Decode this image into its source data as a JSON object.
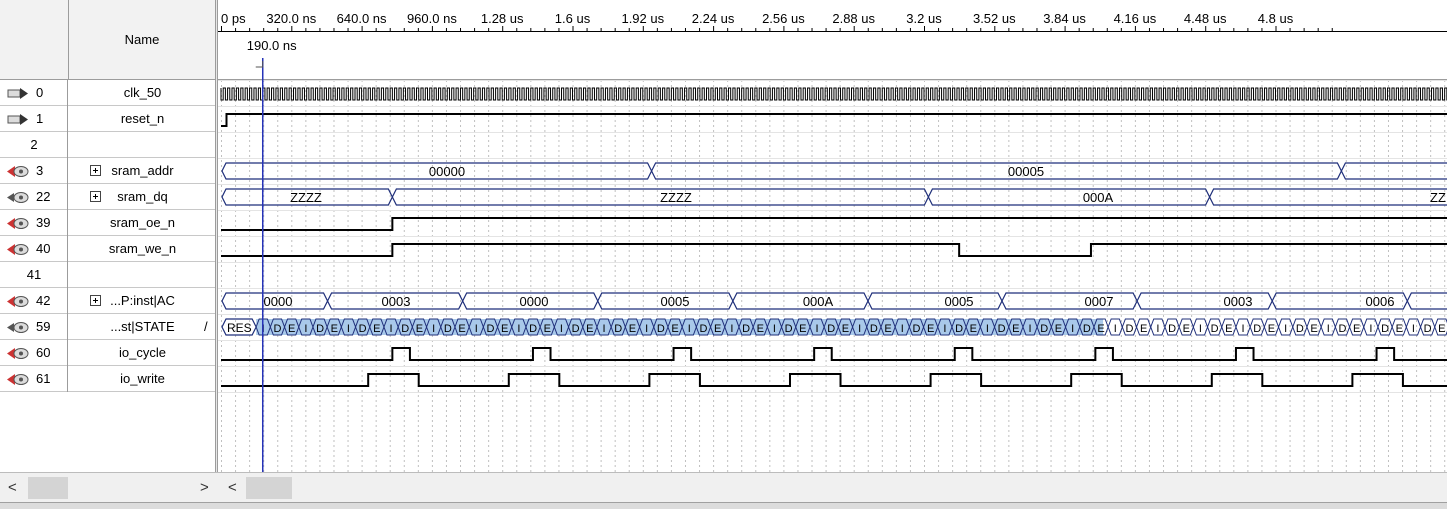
{
  "header": {
    "name_label": "Name"
  },
  "timeline": {
    "ticks": [
      "0 ps",
      "320.0 ns",
      "640.0 ns",
      "960.0 ns",
      "1.28 us",
      "1.6 us",
      "1.92 us",
      "2.24 us",
      "2.56 us",
      "2.88 us",
      "3.2 us",
      "3.52 us",
      "3.84 us",
      "4.16 us",
      "4.48 us",
      "4.8 us"
    ],
    "cursor_label": "190.0 ns",
    "cursor_time_ns": 190.0
  },
  "signals": [
    {
      "index": "0",
      "name": "clk_50",
      "pin": "input"
    },
    {
      "index": "1",
      "name": "reset_n",
      "pin": "input"
    },
    {
      "index": "2",
      "name": "",
      "pin": "none"
    },
    {
      "index": "3",
      "name": "sram_addr",
      "pin": "output",
      "expandable": true
    },
    {
      "index": "22",
      "name": "sram_dq",
      "pin": "bidir",
      "expandable": true
    },
    {
      "index": "39",
      "name": "sram_oe_n",
      "pin": "output"
    },
    {
      "index": "40",
      "name": "sram_we_n",
      "pin": "output"
    },
    {
      "index": "41",
      "name": "",
      "pin": "none"
    },
    {
      "index": "42",
      "name": "...P:inst|AC",
      "pin": "output",
      "expandable": true
    },
    {
      "index": "59",
      "name": "...st|STATE",
      "pin": "bidir",
      "suffix": "/"
    },
    {
      "index": "60",
      "name": "io_cycle",
      "pin": "output"
    },
    {
      "index": "61",
      "name": "io_write",
      "pin": "output"
    }
  ],
  "bus_values": {
    "sram_addr": [
      "00000",
      "00005"
    ],
    "sram_dq": [
      "ZZZZ",
      "ZZZZ",
      "000A",
      "ZZ"
    ],
    "ac": [
      "0000",
      "0003",
      "0000",
      "0005",
      "000A",
      "0005",
      "0007",
      "0003",
      "0006"
    ],
    "state": {
      "first": "RES",
      "cycle": [
        "I",
        "D",
        "E",
        "I",
        "D",
        "E",
        "I",
        "D",
        "E",
        "I",
        "D",
        "E"
      ]
    }
  },
  "scrollbar": {
    "left_arrow": "<",
    "right_arrow": ">",
    "wave_left_arrow": "<"
  },
  "colors": {
    "wave": "#000000",
    "bus": "#1f2f7a",
    "cursor": "#2633b8",
    "state_fill": "#a9c9ea",
    "grid": "#c0c0c0"
  }
}
